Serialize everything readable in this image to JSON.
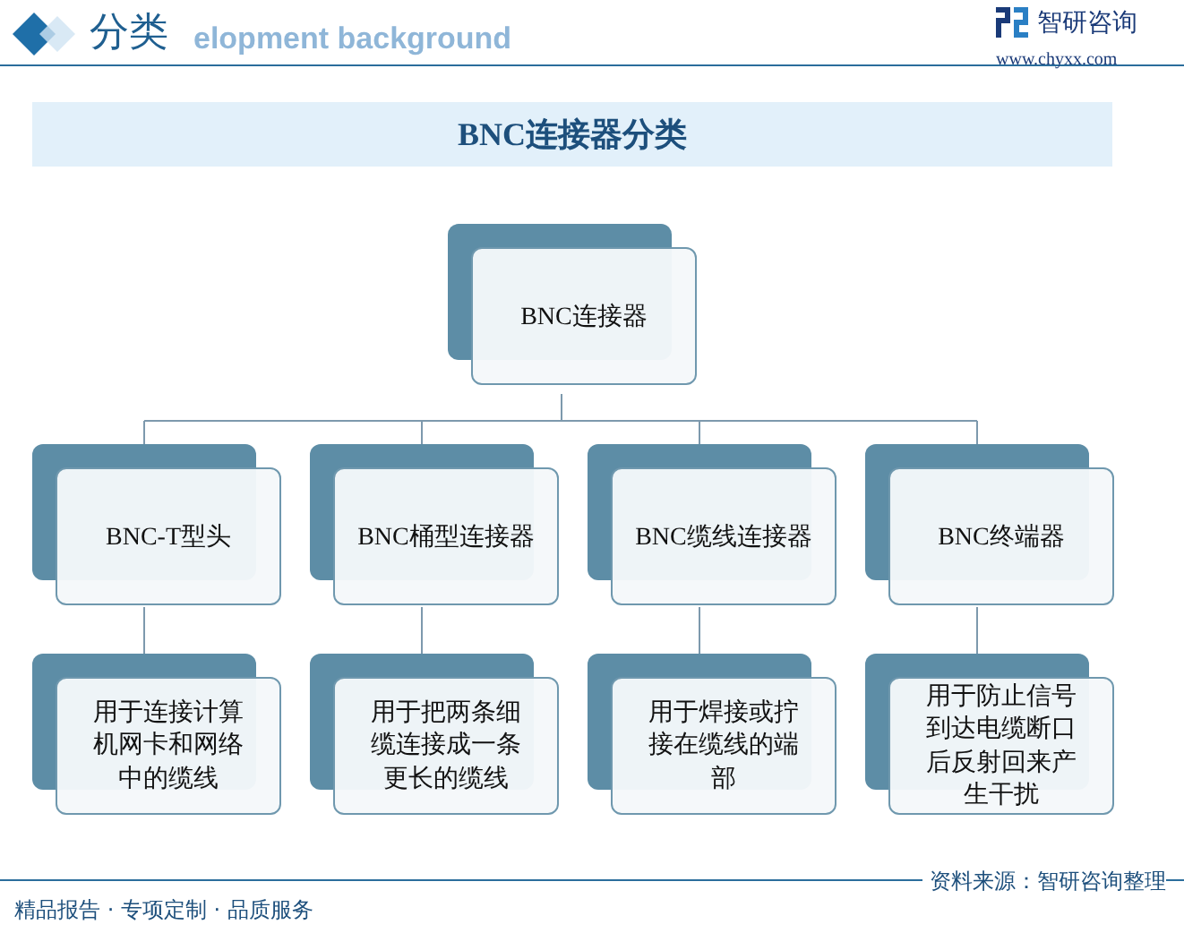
{
  "header": {
    "title": "分类",
    "subtitle": "elopment background",
    "logo": {
      "name": "智研咨询",
      "url": "www.chyxx.com"
    }
  },
  "banner": {
    "title": "BNC连接器分类"
  },
  "tree": {
    "label": "BNC连接器",
    "children": [
      {
        "label": "BNC-T型头",
        "children": [
          {
            "label": "用于连接计算机网卡和网络中的缆线"
          }
        ]
      },
      {
        "label": "BNC桶型连接器",
        "children": [
          {
            "label": "用于把两条细缆连接成一条更长的缆线"
          }
        ]
      },
      {
        "label": "BNC缆线连接器",
        "children": [
          {
            "label": "用于焊接或拧接在缆线的端部"
          }
        ]
      },
      {
        "label": "BNC终端器",
        "children": [
          {
            "label": "用于防止信号到达电缆断口后反射回来产生干扰"
          }
        ]
      }
    ]
  },
  "footer": {
    "slogan": "精品报告 · 专项定制 · 品质服务",
    "source": "资料来源：智研咨询整理"
  }
}
